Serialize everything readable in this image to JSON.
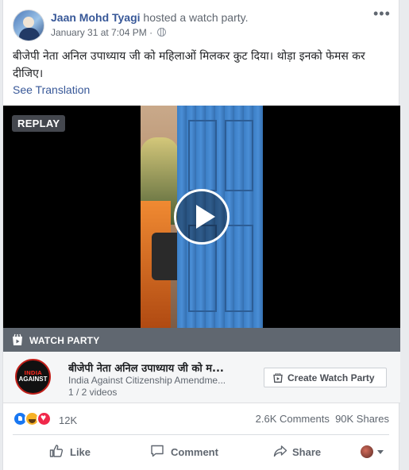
{
  "post": {
    "author": "Jaan Mohd Tyagi",
    "action": " hosted a watch party.",
    "timestamp": "January 31 at 7:04 PM",
    "separator": " · ",
    "privacy_icon": "globe-icon",
    "more_icon": "more-options-icon",
    "text": "बीजेपी नेता अनिल उपाध्याय जी को महिलाओं मिलकर कुट दिया। थोड़ा इनको फेमस कर दीजिए।",
    "see_translation": "See Translation"
  },
  "video": {
    "badge": "REPLAY",
    "play_icon": "play-icon"
  },
  "watch_party": {
    "bar_label": "WATCH PARTY",
    "bar_icon": "watch-party-icon",
    "thumb_line1": "INDIA",
    "thumb_line2": "AGAINST",
    "title": "बीजेपी नेता अनिल उपाध्याय जी को म...",
    "source": "India Against Citizenship Amendme...",
    "count": "1 / 2 videos",
    "create_button": "Create Watch Party"
  },
  "stats": {
    "reaction_icons": [
      "like-reaction-icon",
      "haha-reaction-icon",
      "love-reaction-icon"
    ],
    "reactions_count": "12K",
    "comments": "2.6K Comments",
    "shares": "90K Shares"
  },
  "actions": {
    "like": "Like",
    "comment": "Comment",
    "share": "Share"
  },
  "colors": {
    "link": "#385898",
    "secondary_text": "#606770",
    "like_blue": "#1877f2",
    "haha_yellow": "#f7b125",
    "love_red": "#f0284a"
  }
}
